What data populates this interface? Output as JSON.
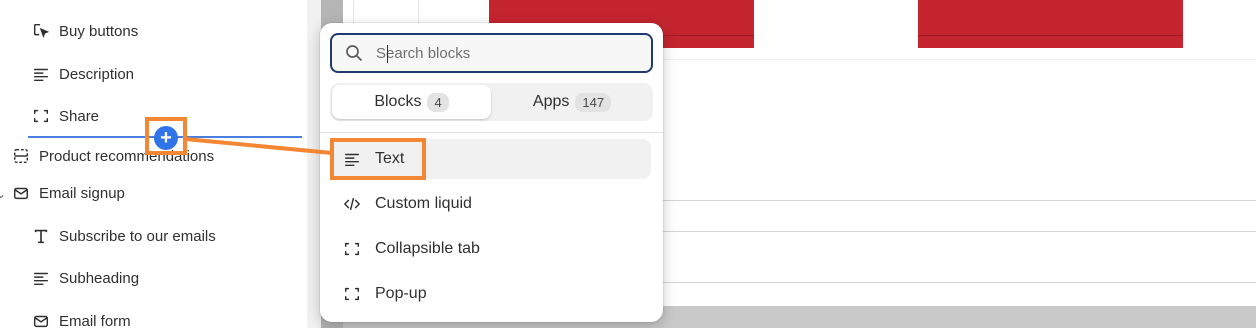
{
  "sidebar": {
    "items": [
      {
        "label": "Buy buttons",
        "icon": "cursor-click-icon"
      },
      {
        "label": "Description",
        "icon": "text-align-left-icon"
      },
      {
        "label": "Share",
        "icon": "dashed-square-icon"
      },
      {
        "label": "Product recommendations",
        "icon": "product-list-icon"
      },
      {
        "label": "Email signup",
        "icon": "envelope-icon"
      },
      {
        "label": "Subscribe to our emails",
        "icon": "text-heading-icon"
      },
      {
        "label": "Subheading",
        "icon": "text-align-left-icon"
      },
      {
        "label": "Email form",
        "icon": "envelope-icon"
      }
    ],
    "add_button": "+"
  },
  "popover": {
    "search": {
      "placeholder": "Search blocks",
      "value": ""
    },
    "tabs": [
      {
        "label": "Blocks",
        "count": "4",
        "active": true
      },
      {
        "label": "Apps",
        "count": "147",
        "active": false
      }
    ],
    "blocks": [
      {
        "label": "Text",
        "icon": "text-align-left-icon",
        "selected": true
      },
      {
        "label": "Custom liquid",
        "icon": "code-icon",
        "selected": false
      },
      {
        "label": "Collapsible tab",
        "icon": "dashed-square-icon",
        "selected": false
      },
      {
        "label": "Pop-up",
        "icon": "dashed-square-icon",
        "selected": false
      }
    ]
  },
  "colors": {
    "accent_blue": "#2f74e8",
    "annotation_orange": "#f58634",
    "preview_red": "#c4252f",
    "search_border": "#1f3b70"
  }
}
